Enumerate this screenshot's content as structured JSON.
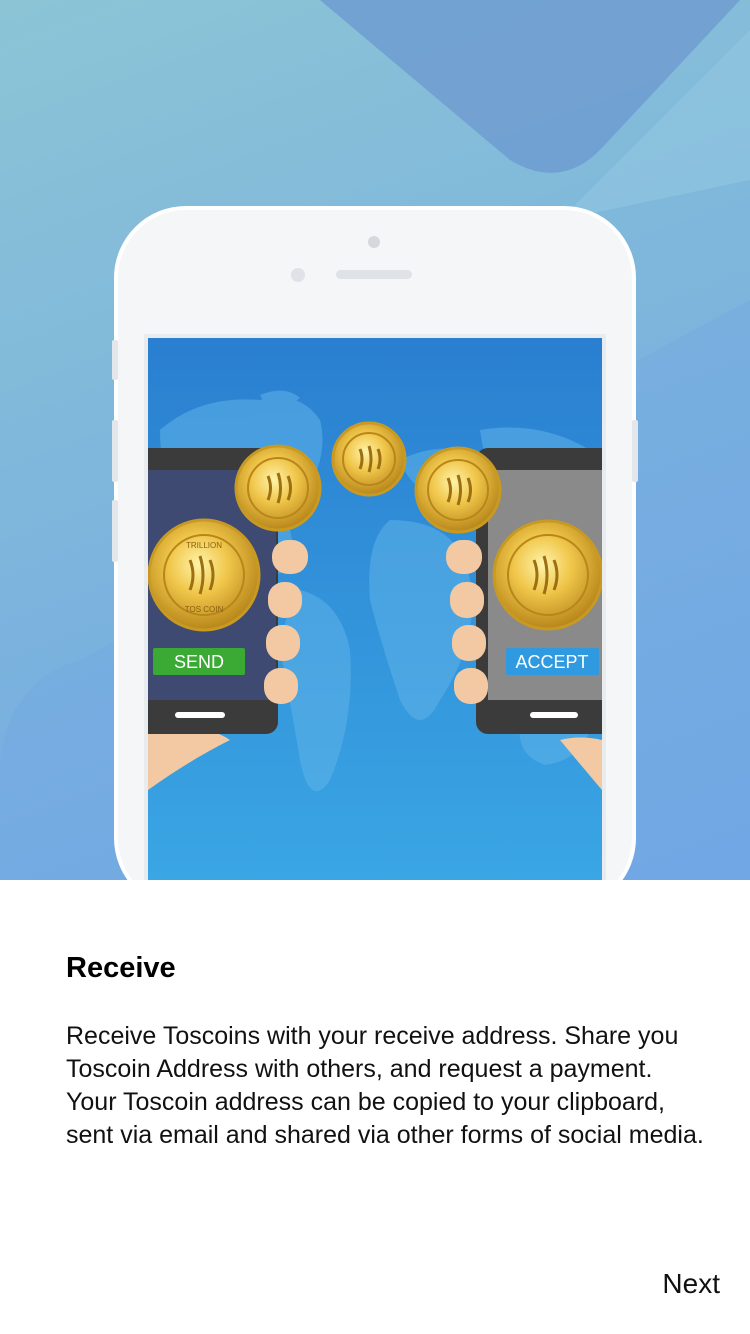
{
  "illustration": {
    "send_label": "SEND",
    "accept_label": "ACCEPT",
    "coin_text_top": "TRILLION",
    "coin_text_bottom": "TOS COIN",
    "colors": {
      "send_button": "#3aaa35",
      "accept_button": "#2f9ae0",
      "map_background": "#2f8fdc",
      "coin_gold": "#e3b53b"
    }
  },
  "onboarding": {
    "title": "Receive",
    "description": "Receive Toscoins with your receive address. Share you Toscoin Address with others, and request a payment. Your Toscoin address can be copied to your clipboard, sent via email and shared via other forms of social media.",
    "next_label": "Next"
  }
}
